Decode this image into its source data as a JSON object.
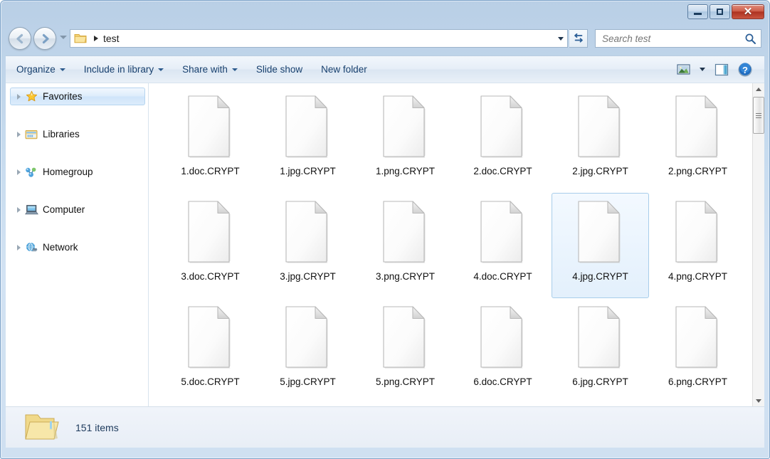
{
  "window": {
    "minimize_label": "Minimize",
    "maximize_label": "Maximize",
    "close_label": "Close"
  },
  "address": {
    "folder_icon": "folder-icon",
    "crumb": "test",
    "dropdown_icon": "chevron-down-icon",
    "refresh_icon": "refresh-icon"
  },
  "search": {
    "placeholder": "Search test",
    "value": "",
    "icon": "search-icon"
  },
  "navigation": {
    "back_icon": "back-arrow-icon",
    "forward_icon": "forward-arrow-icon",
    "history_icon": "history-dropdown-icon"
  },
  "toolbar": {
    "items": [
      {
        "label": "Organize",
        "has_caret": true
      },
      {
        "label": "Include in library",
        "has_caret": true
      },
      {
        "label": "Share with",
        "has_caret": true
      },
      {
        "label": "Slide show",
        "has_caret": false
      },
      {
        "label": "New folder",
        "has_caret": false
      }
    ],
    "view_icon": "change-view-icon",
    "view_caret_icon": "chevron-down-icon",
    "preview_pane_icon": "preview-pane-icon",
    "help_icon": "help-icon"
  },
  "sidebar": {
    "items": [
      {
        "label": "Favorites",
        "icon": "star-icon",
        "selected": true
      },
      {
        "label": "Libraries",
        "icon": "libraries-icon",
        "selected": false
      },
      {
        "label": "Homegroup",
        "icon": "homegroup-icon",
        "selected": false
      },
      {
        "label": "Computer",
        "icon": "computer-icon",
        "selected": false
      },
      {
        "label": "Network",
        "icon": "network-icon",
        "selected": false
      }
    ]
  },
  "files": [
    {
      "name": "1.doc.CRYPT",
      "selected": false
    },
    {
      "name": "1.jpg.CRYPT",
      "selected": false
    },
    {
      "name": "1.png.CRYPT",
      "selected": false
    },
    {
      "name": "2.doc.CRYPT",
      "selected": false
    },
    {
      "name": "2.jpg.CRYPT",
      "selected": false
    },
    {
      "name": "2.png.CRYPT",
      "selected": false
    },
    {
      "name": "3.doc.CRYPT",
      "selected": false
    },
    {
      "name": "3.jpg.CRYPT",
      "selected": false
    },
    {
      "name": "3.png.CRYPT",
      "selected": false
    },
    {
      "name": "4.doc.CRYPT",
      "selected": false
    },
    {
      "name": "4.jpg.CRYPT",
      "selected": true
    },
    {
      "name": "4.png.CRYPT",
      "selected": false
    },
    {
      "name": "5.doc.CRYPT",
      "selected": false
    },
    {
      "name": "5.jpg.CRYPT",
      "selected": false
    },
    {
      "name": "5.png.CRYPT",
      "selected": false
    },
    {
      "name": "6.doc.CRYPT",
      "selected": false
    },
    {
      "name": "6.jpg.CRYPT",
      "selected": false
    },
    {
      "name": "6.png.CRYPT",
      "selected": false
    }
  ],
  "statusbar": {
    "item_count": "151 items",
    "folder_icon": "folder-icon"
  },
  "scrollbar": {
    "up_icon": "scroll-up-arrow-icon",
    "down_icon": "scroll-down-arrow-icon",
    "thumb": "scroll-thumb"
  },
  "colors": {
    "frame": "#c8dcef",
    "accent": "#18406e",
    "close_button": "#ad3221",
    "selection": "#cfe4fa"
  }
}
